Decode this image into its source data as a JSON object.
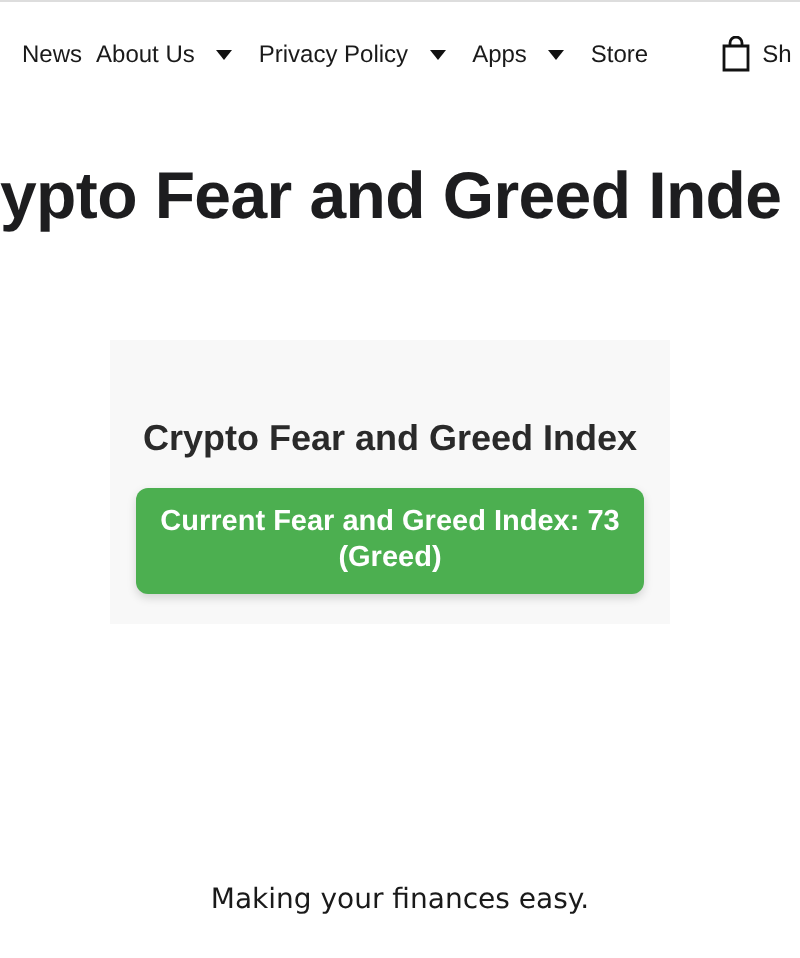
{
  "nav": {
    "items": [
      {
        "label": "News",
        "dropdown": false
      },
      {
        "label": "About Us",
        "dropdown": true
      },
      {
        "label": "Privacy Policy",
        "dropdown": true
      },
      {
        "label": "Apps",
        "dropdown": true
      },
      {
        "label": "Store",
        "dropdown": false
      }
    ],
    "cart_label": "Sh"
  },
  "page_title": "ypto Fear and Greed Inde",
  "widget": {
    "heading": "Crypto Fear and Greed Index",
    "index_banner": "Current Fear and Greed Index: 73 (Greed)"
  },
  "tagline": "Making your finances easy."
}
